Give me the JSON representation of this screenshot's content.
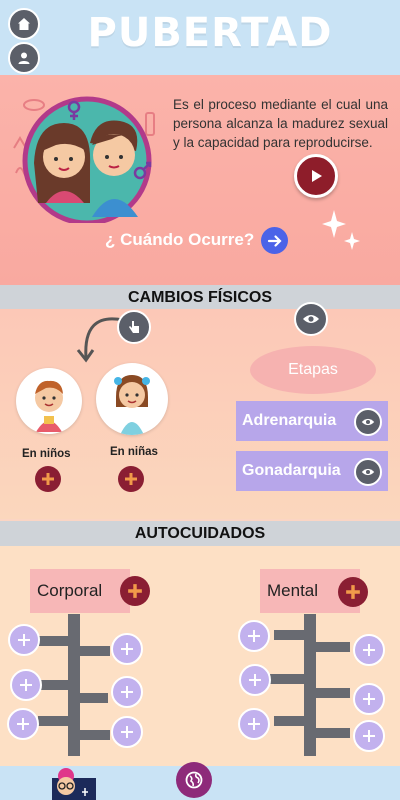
{
  "header": {
    "title": "PUBERTAD",
    "home_icon": "home-icon",
    "user_icon": "user-icon"
  },
  "hero": {
    "description": "Es el proceso mediante el cual una persona alcanza la madurez sexual y la capacidad para reproducirse.",
    "when_label": "¿ Cuándo Ocurre?",
    "play_icon": "play-icon"
  },
  "sections": {
    "physical": "CAMBIOS FÍSICOS",
    "selfcare": "AUTOCUIDADOS"
  },
  "physical": {
    "boys_label": "En niños",
    "girls_label": "En niñas",
    "stages_title": "Etapas",
    "stages": [
      "Adrenarquia",
      "Gonadarquia"
    ]
  },
  "selfcare": {
    "corporal": "Corporal",
    "mental": "Mental"
  },
  "colors": {
    "header": "#c9e3f5",
    "maroon": "#8a1e33",
    "purple": "#b7a6ea",
    "accent_blue": "#4b63e8"
  }
}
